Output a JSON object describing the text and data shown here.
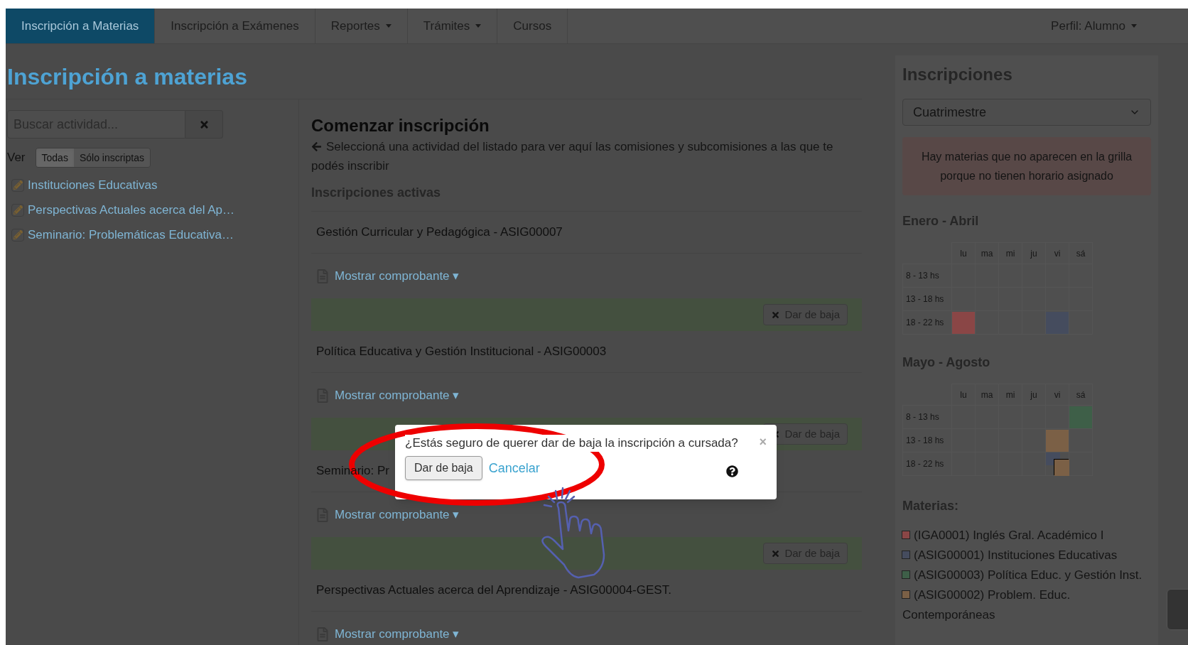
{
  "nav": {
    "items": [
      {
        "label": "Inscripción a Materias",
        "selected": true,
        "dropdown": false
      },
      {
        "label": "Inscripción a Exámenes",
        "selected": false,
        "dropdown": false
      },
      {
        "label": "Reportes",
        "selected": false,
        "dropdown": true
      },
      {
        "label": "Trámites",
        "selected": false,
        "dropdown": true
      },
      {
        "label": "Cursos",
        "selected": false,
        "dropdown": false
      }
    ],
    "profile": {
      "label": "Perfil: Alumno",
      "dropdown": true
    }
  },
  "page_title": "Inscripción a materias",
  "sidebar": {
    "search": {
      "placeholder": "Buscar actividad..."
    },
    "filter": {
      "label": "Ver",
      "options": [
        {
          "label": "Todas",
          "selected": true
        },
        {
          "label": "Sólo inscriptas",
          "selected": false
        }
      ]
    },
    "activities": [
      "Instituciones Educativas",
      "Perspectivas Actuales acerca del Ap…",
      "Seminario: Problemáticas Educativa…"
    ]
  },
  "main": {
    "title": "Comenzar inscripción",
    "hint": "Seleccioná una actividad del listado para ver aquí las comisiones y subcomisiones a las que te podés inscribir",
    "active_title": "Inscripciones activas",
    "enrollments": [
      {
        "title": "Gestión Curricular y Pedagógica - ASIG00007",
        "link": "Mostrar comprobante ▾",
        "action": "Dar de baja"
      },
      {
        "title": "Política Educativa y Gestión Institucional - ASIG00003",
        "link": "Mostrar comprobante ▾",
        "action": "Dar de baja"
      },
      {
        "title": "Seminario: Pr",
        "link": "Mostrar comprobante ▾",
        "action": "Dar de baja"
      },
      {
        "title": "Perspectivas Actuales acerca del Aprendizaje - ASIG00004-GEST.",
        "link": "Mostrar comprobante ▾"
      }
    ]
  },
  "inscripciones": {
    "title": "Inscripciones",
    "select": {
      "value": "Cuatrimestre"
    },
    "alert": "Hay materias que no aparecen en la grilla porque no tienen horario asignado",
    "calendars": [
      {
        "title": "Enero - Abril",
        "days": [
          "lu",
          "ma",
          "mi",
          "ju",
          "vi",
          "sá"
        ],
        "rows": [
          {
            "label": "8 - 13 hs",
            "cells": [
              null,
              null,
              null,
              null,
              null,
              null
            ]
          },
          {
            "label": "13 - 18 hs",
            "cells": [
              null,
              null,
              null,
              null,
              null,
              null
            ]
          },
          {
            "label": "18 - 22 hs",
            "cells": [
              {
                "blocks": [
                  {
                    "color": "#8a4646"
                  }
                ]
              },
              null,
              null,
              null,
              {
                "blocks": [
                  {
                    "color": "#454c5e"
                  }
                ]
              },
              null
            ]
          }
        ]
      },
      {
        "title": "Mayo - Agosto",
        "days": [
          "lu",
          "ma",
          "mi",
          "ju",
          "vi",
          "sá"
        ],
        "rows": [
          {
            "label": "8 - 13 hs",
            "cells": [
              null,
              null,
              null,
              null,
              null,
              {
                "blocks": [
                  {
                    "color": "#3e5f48"
                  }
                ]
              }
            ]
          },
          {
            "label": "13 - 18 hs",
            "cells": [
              null,
              null,
              null,
              null,
              {
                "blocks": [
                  {
                    "color": "#7b6046"
                  }
                ]
              },
              null
            ]
          },
          {
            "label": "18 - 22 hs",
            "cells": [
              null,
              null,
              null,
              null,
              {
                "blocks": [
                  {
                    "color": "#454c5e"
                  },
                  {
                    "color": "#7b6046"
                  }
                ]
              },
              null
            ]
          }
        ]
      }
    ],
    "materias_title": "Materias:",
    "materias": [
      {
        "label": "(IGA0001) Inglés Gral. Académico I",
        "color": "#8a4646"
      },
      {
        "label": "(ASIG00001) Instituciones Educativas",
        "color": "#454c5e"
      },
      {
        "label": "(ASIG00003) Política Educ. y Gestión Inst.",
        "color": "#3e5f48"
      },
      {
        "label": "(ASIG00002) Problem. Educ. Contemporáneas",
        "color": "#7b6046"
      }
    ]
  },
  "dialog": {
    "message": "¿Estás seguro de querer dar de baja la inscripción a cursada?",
    "close": "×",
    "confirm": "Dar de baja",
    "cancel": "Cancelar"
  }
}
